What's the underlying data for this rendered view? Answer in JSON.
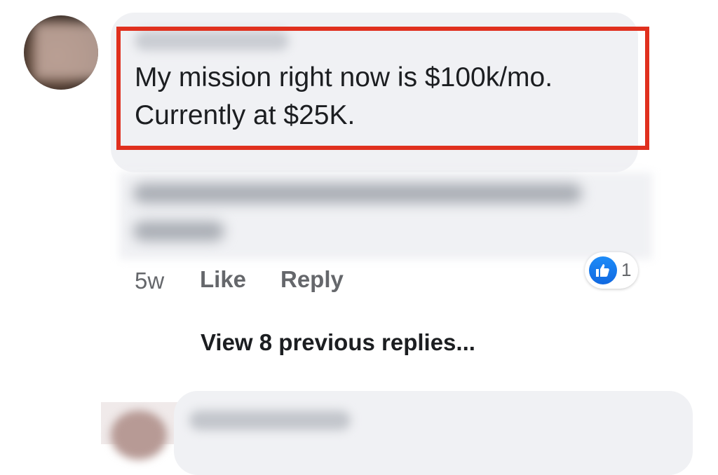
{
  "comment": {
    "text_line1": "My mission right now is $100k/mo.",
    "text_line2": "Currently at $25K.",
    "time": "5w",
    "like_label": "Like",
    "reply_label": "Reply",
    "reaction": {
      "icon": "thumbs-up-icon",
      "count": "1",
      "color": "#1877f2"
    },
    "highlight_color": "#e0301e"
  },
  "thread": {
    "view_replies_label": "View 8 previous replies..."
  }
}
